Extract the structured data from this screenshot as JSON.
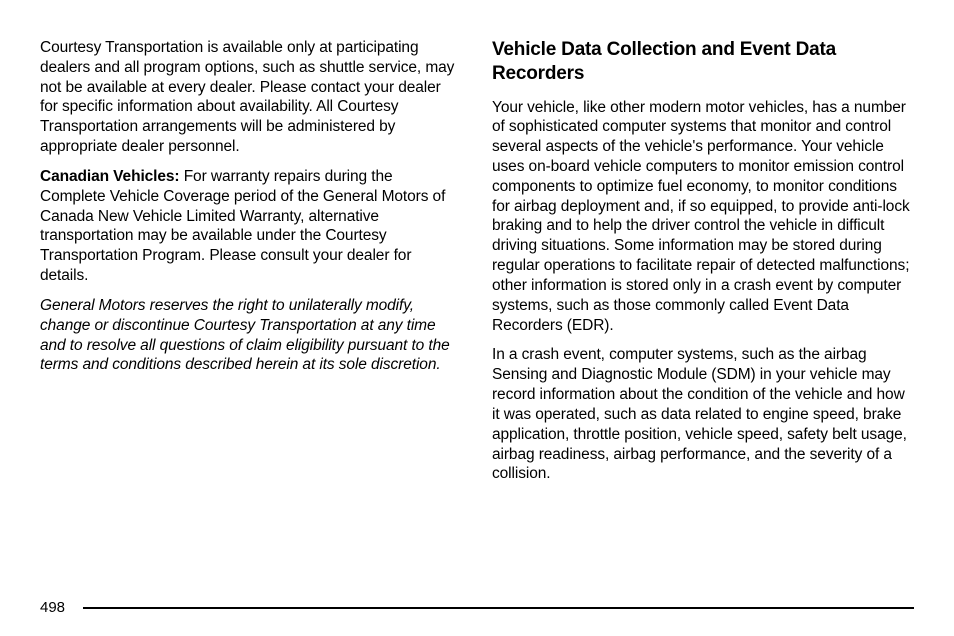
{
  "leftCol": {
    "p1": "Courtesy Transportation is available only at participating dealers and all program options, such as shuttle service, may not be available at every dealer. Please contact your dealer for specific information about availability. All Courtesy Transportation arrangements will be administered by appropriate dealer personnel.",
    "p2_bold": "Canadian Vehicles:",
    "p2_rest": " For warranty repairs during the Complete Vehicle Coverage period of the General Motors of Canada New Vehicle Limited Warranty, alternative transportation may be available under the Courtesy Transportation Program. Please consult your dealer for details.",
    "p3": "General Motors reserves the right to unilaterally modify, change or discontinue Courtesy Transportation at any time and to resolve all questions of claim eligibility pursuant to the terms and conditions described herein at its sole discretion."
  },
  "rightCol": {
    "heading": "Vehicle Data Collection and Event Data Recorders",
    "p1": "Your vehicle, like other modern motor vehicles, has a number of sophisticated computer systems that monitor and control several aspects of the vehicle's performance. Your vehicle uses on-board vehicle computers to monitor emission control components to optimize fuel economy, to monitor conditions for airbag deployment and, if so equipped, to provide anti-lock braking and to help the driver control the vehicle in difficult driving situations. Some information may be stored during regular operations to facilitate repair of detected malfunctions; other information is stored only in a crash event by computer systems, such as those commonly called Event Data Recorders (EDR).",
    "p2": "In a crash event, computer systems, such as the airbag Sensing and Diagnostic Module (SDM) in your vehicle may record information about the condition of the vehicle and how it was operated, such as data related to engine speed, brake application, throttle position, vehicle speed, safety belt usage, airbag readiness, airbag performance, and the severity of a collision."
  },
  "pageNumber": "498"
}
